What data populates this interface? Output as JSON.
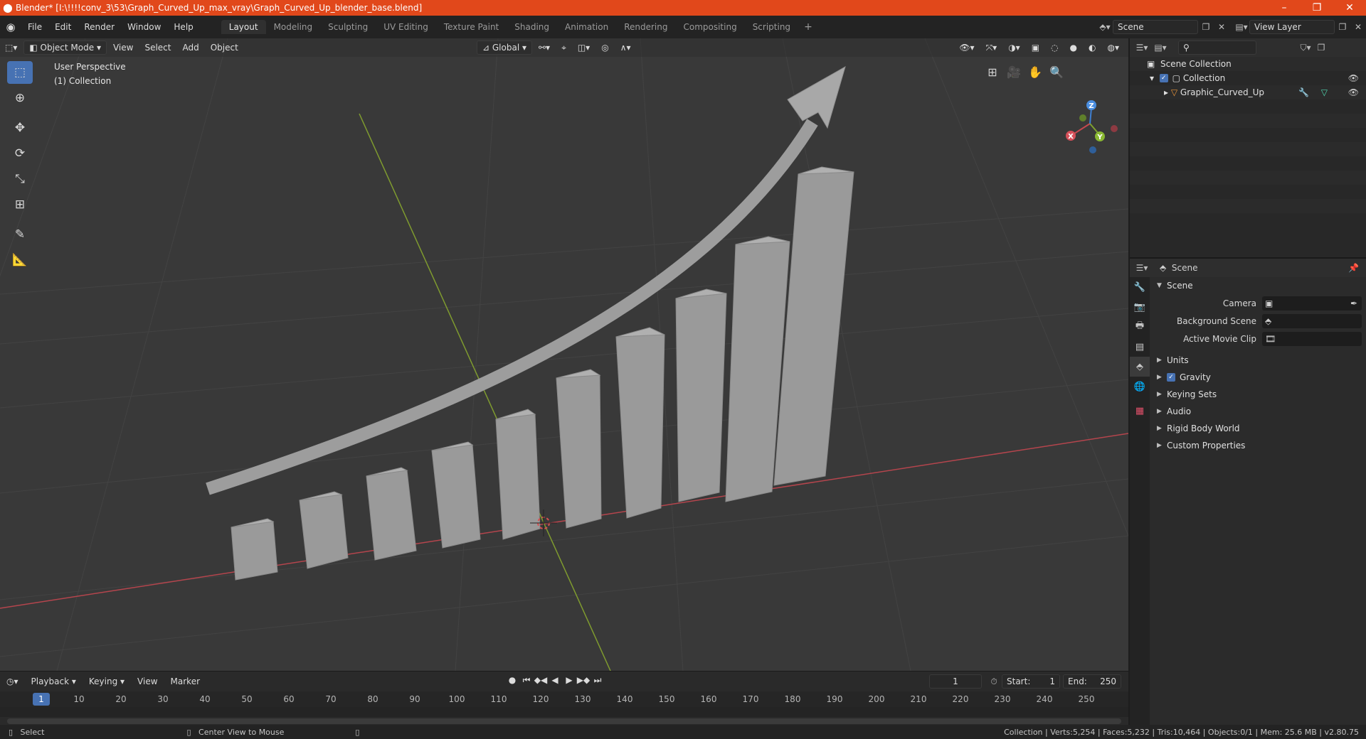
{
  "window": {
    "title": "Blender* [I:\\!!!!conv_3\\53\\Graph_Curved_Up_max_vray\\Graph_Curved_Up_blender_base.blend]",
    "minimize": "–",
    "maximize": "❐",
    "close": "✕"
  },
  "menu": {
    "items": [
      "File",
      "Edit",
      "Render",
      "Window",
      "Help"
    ],
    "workspaces": [
      "Layout",
      "Modeling",
      "Sculpting",
      "UV Editing",
      "Texture Paint",
      "Shading",
      "Animation",
      "Rendering",
      "Compositing",
      "Scripting"
    ],
    "active_workspace": "Layout",
    "add_tab": "+",
    "scene_name": "Scene",
    "view_layer": "View Layer"
  },
  "viewport": {
    "mode": "Object Mode",
    "menus": [
      "View",
      "Select",
      "Add",
      "Object"
    ],
    "orientation": "Global",
    "info_line1": "User Perspective",
    "info_line2": "(1) Collection",
    "gizmo": {
      "x": "X",
      "y": "Y",
      "z": "Z"
    },
    "colors": {
      "bg": "#393939",
      "grid": "#444444",
      "x_axis": "#c4474f",
      "y_axis": "#7f9b2f",
      "object": "#9b9b9b",
      "active_tool": "#4772b3"
    }
  },
  "timeline": {
    "menus": [
      "Playback",
      "Keying",
      "View",
      "Marker"
    ],
    "current_frame": "1",
    "start_label": "Start:",
    "start": "1",
    "end_label": "End:",
    "end": "250",
    "ruler": [
      "10",
      "20",
      "30",
      "40",
      "50",
      "60",
      "70",
      "80",
      "90",
      "100",
      "110",
      "120",
      "130",
      "140",
      "150",
      "160",
      "170",
      "180",
      "190",
      "200",
      "210",
      "220",
      "230",
      "240",
      "250"
    ],
    "ruler_current": "1"
  },
  "statusbar": {
    "left_action": "Select",
    "middle_action": "Center View to Mouse",
    "stats": "Collection | Verts:5,254 | Faces:5,232 | Tris:10,464 | Objects:0/1 | Mem: 25.6 MB | v2.80.75"
  },
  "outliner": {
    "rows": [
      {
        "label": "Scene Collection"
      },
      {
        "label": "Collection"
      },
      {
        "label": "Graphic_Curved_Up"
      }
    ]
  },
  "properties": {
    "header_title": "Scene",
    "section": "Scene",
    "fields": [
      {
        "label": "Camera"
      },
      {
        "label": "Background Scene"
      },
      {
        "label": "Active Movie Clip"
      }
    ],
    "panels": [
      "Units",
      "Gravity",
      "Keying Sets",
      "Audio",
      "Rigid Body World",
      "Custom Properties"
    ]
  }
}
